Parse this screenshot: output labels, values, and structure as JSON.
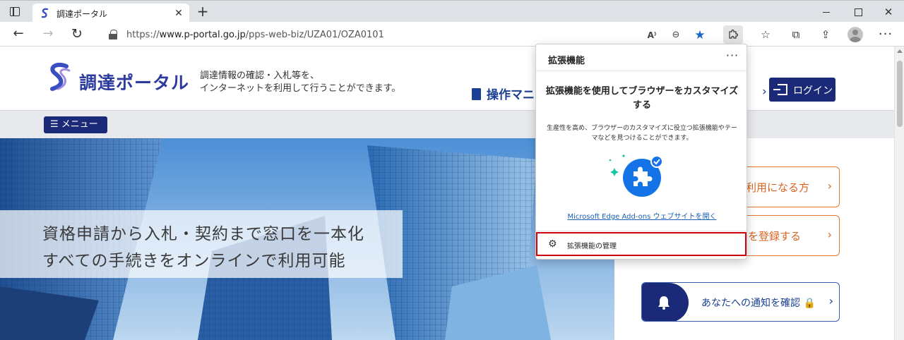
{
  "browser": {
    "tab_title": "調達ポータル",
    "url_prefix": "https://",
    "url_host": "www.p-portal.go.jp",
    "url_path": "/pps-web-biz/UZA01/OZA0101",
    "icons": {
      "tab_actions": "tab-actions-icon",
      "new_tab": "+",
      "back": "←",
      "forward": "→",
      "reload": "↻",
      "read_aloud": "A⁾",
      "zoom_out": "⊖",
      "favorite": "★",
      "extensions": "puzzle-icon",
      "favorites_bar": "☆",
      "collections": "⧉",
      "share": "⇪",
      "more": "···",
      "close_tab": "✕",
      "close_window": "✕"
    }
  },
  "site": {
    "logo_text": "調達ポータル",
    "tagline_1": "調達情報の確認・入札等を、",
    "tagline_2": "インターネットを利用して行うことができます。",
    "manual_label": "操作マニ",
    "header_arrow": "›",
    "login_label": "ログイン",
    "menu_label": "☰ メニュー",
    "hero_line_1": "資格申請から入札・契約まで窓口を一本化",
    "hero_line_2": "すべての手続きをオンラインで利用可能",
    "side_button_1": "ご利用になる方",
    "side_button_2": "を登録する",
    "notify_label": "あなたへの通知を確認 🔒",
    "chevron": "›"
  },
  "extensions_popup": {
    "title": "拡張機能",
    "more": "···",
    "heading": "拡張機能を使用してブラウザーをカスタマイズする",
    "description": "生産性を高め、ブラウザーのカスタマイズに役立つ拡張機能やテーマなどを見つけることができます。",
    "addons_link": "Microsoft Edge Add-ons ウェブサイトを開く",
    "manage_label": "拡張機能の管理",
    "manage_icon": "⚙"
  },
  "colors": {
    "brand_navy": "#1a2a78",
    "accent_orange": "#d9641f",
    "edge_blue": "#1a66c8",
    "highlight_red": "#d0000f"
  }
}
